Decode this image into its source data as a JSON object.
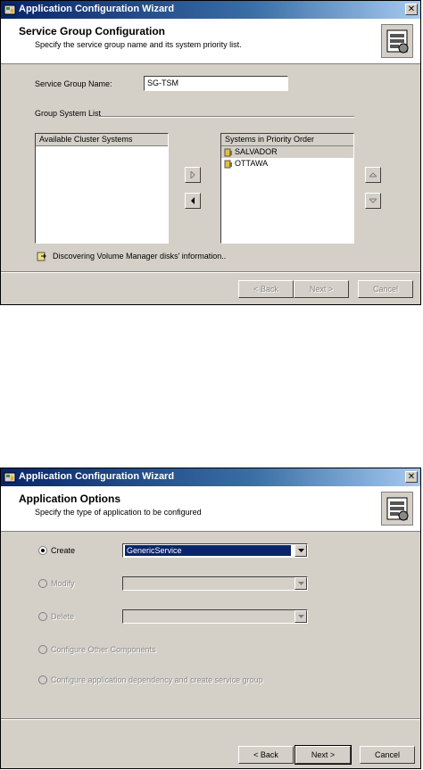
{
  "window1": {
    "title": "Application Configuration Wizard",
    "header_title": "Service Group Configuration",
    "header_subtitle": "Specify the service group name and its system priority list.",
    "service_group_name_label": "Service Group Name:",
    "service_group_name_value": "SG-TSM",
    "group_system_list_label": "Group System List",
    "available_header": "Available Cluster Systems",
    "available_items": [],
    "priority_header": "Systems in Priority Order",
    "priority_items": [
      "SALVADOR",
      "OTTAWA"
    ],
    "status_text": "Discovering Volume Manager disks' information..",
    "buttons": {
      "back": "< Back",
      "next": "Next >",
      "cancel": "Cancel"
    }
  },
  "window2": {
    "title": "Application Configuration Wizard",
    "header_title": "Application Options",
    "header_subtitle": "Specify the type of application to be configured",
    "options": {
      "create": "Create",
      "modify": "Modify",
      "delete": "Delete",
      "configure_other": "Configure Other Components",
      "configure_dependency": "Configure application dependency and create service group"
    },
    "create_value": "GenericService",
    "buttons": {
      "back": "< Back",
      "next": "Next >",
      "cancel": "Cancel"
    }
  }
}
